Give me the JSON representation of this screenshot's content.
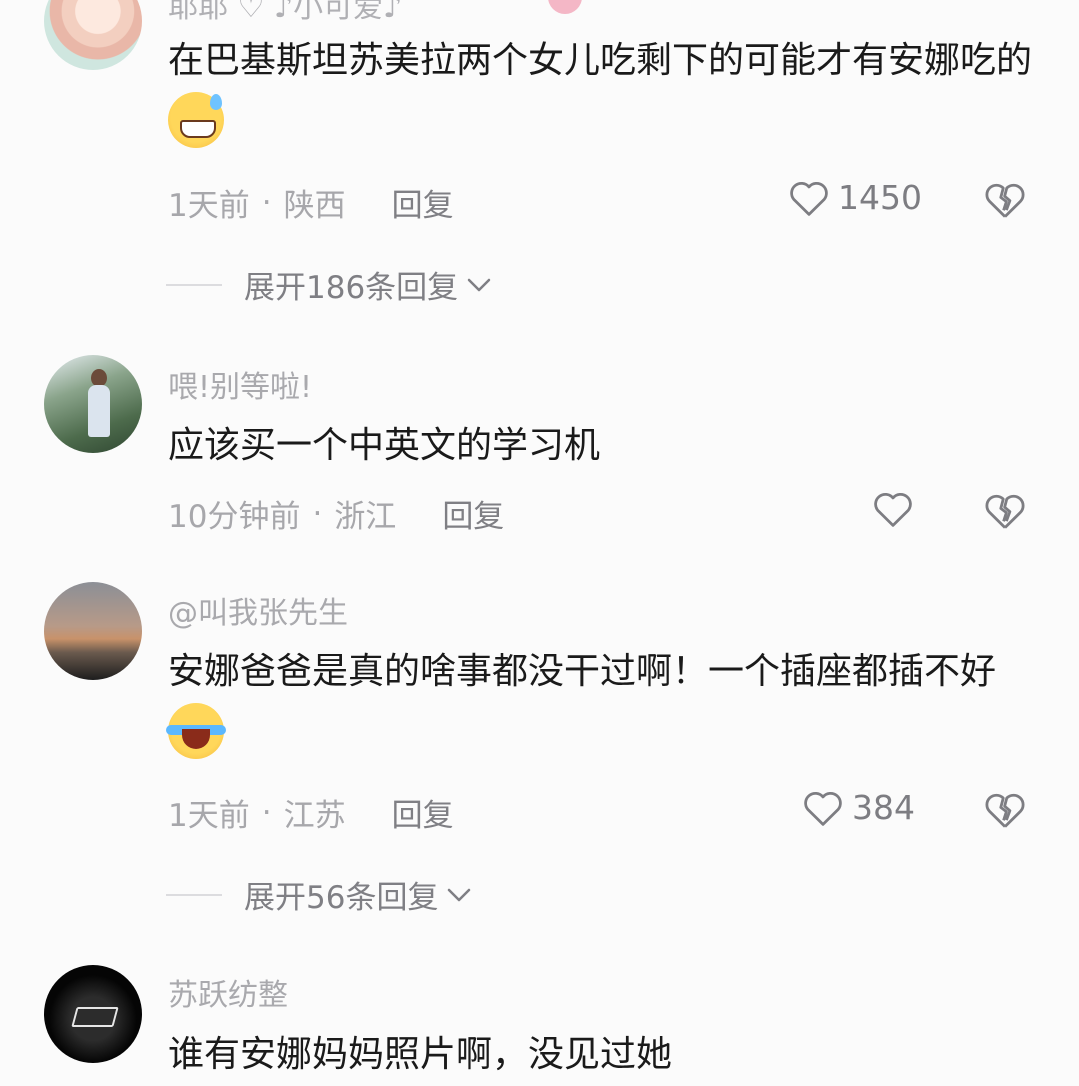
{
  "top_fragment": "耶耶 ♡ ♪小可爱♪",
  "colors": {
    "text_primary": "#1a1a1a",
    "text_secondary": "#a7a7ab",
    "action": "#7f7f84",
    "background": "#fbfbfb"
  },
  "comments": [
    {
      "username": "",
      "text": "在巴基斯坦苏美拉两个女儿吃剩下的可能才有安娜吃的",
      "emoji": "grinning-sweat",
      "time": "1天前",
      "location": "陕西",
      "reply_label": "回复",
      "likes": "1450",
      "expand_label": "展开186条回复"
    },
    {
      "username": "喂!别等啦!",
      "text": "应该买一个中英文的学习机",
      "time": "10分钟前",
      "location": "浙江",
      "reply_label": "回复",
      "likes": ""
    },
    {
      "username": "@叫我张先生",
      "text": "安娜爸爸是真的啥事都没干过啊！一个插座都插不好",
      "emoji": "facepalm-cry",
      "time": "1天前",
      "location": "江苏",
      "reply_label": "回复",
      "likes": "384",
      "expand_label": "展开56条回复"
    },
    {
      "username": "苏跃纺整",
      "text": "谁有安娜妈妈照片啊，没见过她"
    }
  ],
  "separator": "·",
  "icons": {
    "like": "heart-outline-icon",
    "dislike": "broken-heart-icon",
    "expand": "chevron-down-icon"
  }
}
